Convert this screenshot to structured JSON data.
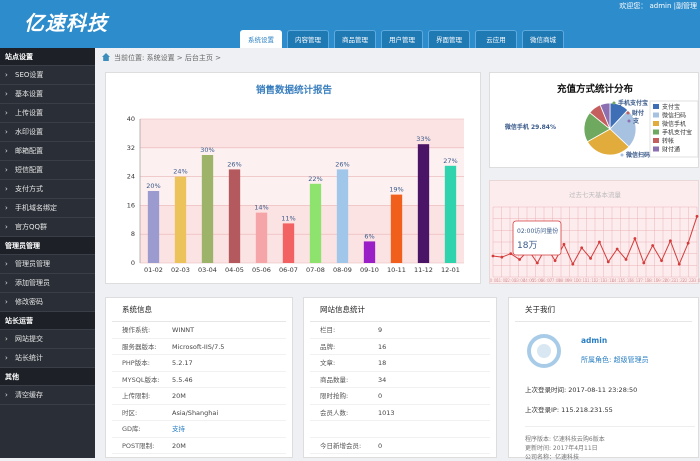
{
  "header": {
    "logo": "亿速科技",
    "welcome": "欢迎您： admin |副管理",
    "tabs": [
      {
        "label": "系统设置",
        "active": true
      },
      {
        "label": "内容管理"
      },
      {
        "label": "商品管理"
      },
      {
        "label": "用户管理"
      },
      {
        "label": "界面管理"
      },
      {
        "label": "云应用"
      },
      {
        "label": "微信商城"
      }
    ]
  },
  "sidebar": {
    "groups": [
      {
        "title": "站点设置",
        "items": [
          "SEO设置",
          "基本设置",
          "上传设置",
          "水印设置",
          "邮箱配置",
          "短信配置",
          "支付方式",
          "手机域名绑定",
          "官方QQ群"
        ]
      },
      {
        "title": "管理员管理",
        "items": [
          "管理员管理",
          "添加管理员",
          "修改密码"
        ]
      },
      {
        "title": "站长运营",
        "items": [
          "网站提交",
          "站长统计"
        ]
      },
      {
        "title": "其他",
        "items": [
          "清空缓存"
        ]
      }
    ]
  },
  "breadcrumb": "当前位置: 系统设置 > 后台主页 >",
  "chart_data": [
    {
      "type": "bar",
      "title": "销售数据统计报告",
      "categories": [
        "01-02",
        "02-03",
        "03-04",
        "04-05",
        "05-06",
        "06-07",
        "07-08",
        "08-09",
        "09-10",
        "10-11",
        "11-12",
        "12-01"
      ],
      "values": [
        20,
        24,
        30,
        26,
        14,
        11,
        22,
        26,
        6,
        19,
        33,
        27
      ],
      "data_labels": [
        "20%",
        "24%",
        "30%",
        "26%",
        "14%",
        "11%",
        "22%",
        "26%",
        "6%",
        "19%",
        "33%",
        "27%"
      ],
      "ylim": [
        0,
        40
      ],
      "yticks": [
        "0",
        "8",
        "16",
        "24",
        "32",
        "40"
      ],
      "colors": [
        "#9b9bd0",
        "#ecc35a",
        "#9db36a",
        "#b4595d",
        "#f5a4a8",
        "#f36262",
        "#8ee36e",
        "#a0c6ea",
        "#9b1fc7",
        "#f05f1c",
        "#4a1467",
        "#2fd3ae"
      ],
      "grid": true
    },
    {
      "type": "pie",
      "title": "充值方式统计分布",
      "categories": [
        "支付宝",
        "微信扫码",
        "微信手机",
        "手机支付宝",
        "转帐",
        "财付通"
      ],
      "values": [
        12,
        25,
        29.84,
        19,
        8,
        6.16
      ],
      "colors": [
        "#3e6fb6",
        "#a7c1e0",
        "#e2ac3c",
        "#6ea95f",
        "#c55f5f",
        "#8c6fb0"
      ],
      "labels": [
        "手机支付宝",
        "财付",
        "支",
        "微信手机 29.84%",
        "微信扫码"
      ],
      "legend_position": "right"
    },
    {
      "type": "line",
      "title": "过去七天基本流量",
      "categories": [
        "00:01",
        "01:02",
        "02:03",
        "03:04",
        "04:05",
        "05:06",
        "06:07",
        "07:08",
        "08:09",
        "09:10",
        "10:11",
        "11:12",
        "12:13",
        "13:14",
        "14:15",
        "15:16",
        "16:17",
        "17:18",
        "18:19",
        "19:20",
        "20:21",
        "21:22",
        "22:23",
        "23:00"
      ],
      "values": [
        18,
        17,
        20,
        15,
        23,
        12,
        26,
        14,
        28,
        11,
        25,
        16,
        30,
        13,
        24,
        15,
        33,
        12,
        27,
        14,
        31,
        11,
        29,
        52
      ],
      "tooltip": {
        "label": "02:00访问量份",
        "value": "18万"
      }
    }
  ],
  "system_info": {
    "title": "系统信息",
    "rows": [
      {
        "k": "操作系统:",
        "v": "WINNT"
      },
      {
        "k": "服务器版本:",
        "v": "Microsoft-IIS/7.5"
      },
      {
        "k": "PHP版本:",
        "v": "5.2.17"
      },
      {
        "k": "MYSQL版本:",
        "v": "5.5.46"
      },
      {
        "k": "上传限制:",
        "v": "20M"
      },
      {
        "k": "时区:",
        "v": "Asia/Shanghai"
      },
      {
        "k": "GD库:",
        "v": "支持",
        "link": true
      },
      {
        "k": "POST限制:",
        "v": "20M"
      }
    ]
  },
  "site_stats": {
    "title": "网站信息统计",
    "rows": [
      {
        "k": "栏目:",
        "v": "9"
      },
      {
        "k": "品牌:",
        "v": "16"
      },
      {
        "k": "文章:",
        "v": "18"
      },
      {
        "k": "商品数量:",
        "v": "34"
      },
      {
        "k": "限时抢购:",
        "v": "0"
      },
      {
        "k": "会员人数:",
        "v": "1013"
      },
      {
        "k": "",
        "v": ""
      },
      {
        "k": "今日新增会员:",
        "v": "0"
      }
    ]
  },
  "about": {
    "title": "关于我们",
    "name": "admin",
    "role": "所属角色: 超级管理员",
    "last_login": "上次登录时间: 2017-08-11 23:28:50",
    "last_ip": "上次登录IP: 115.218.231.55",
    "version": "程序版本: 亿速科技云购6版本",
    "updated": "更新时间: 2017年4月11日",
    "copyright": "公司名称：亿速科技"
  }
}
